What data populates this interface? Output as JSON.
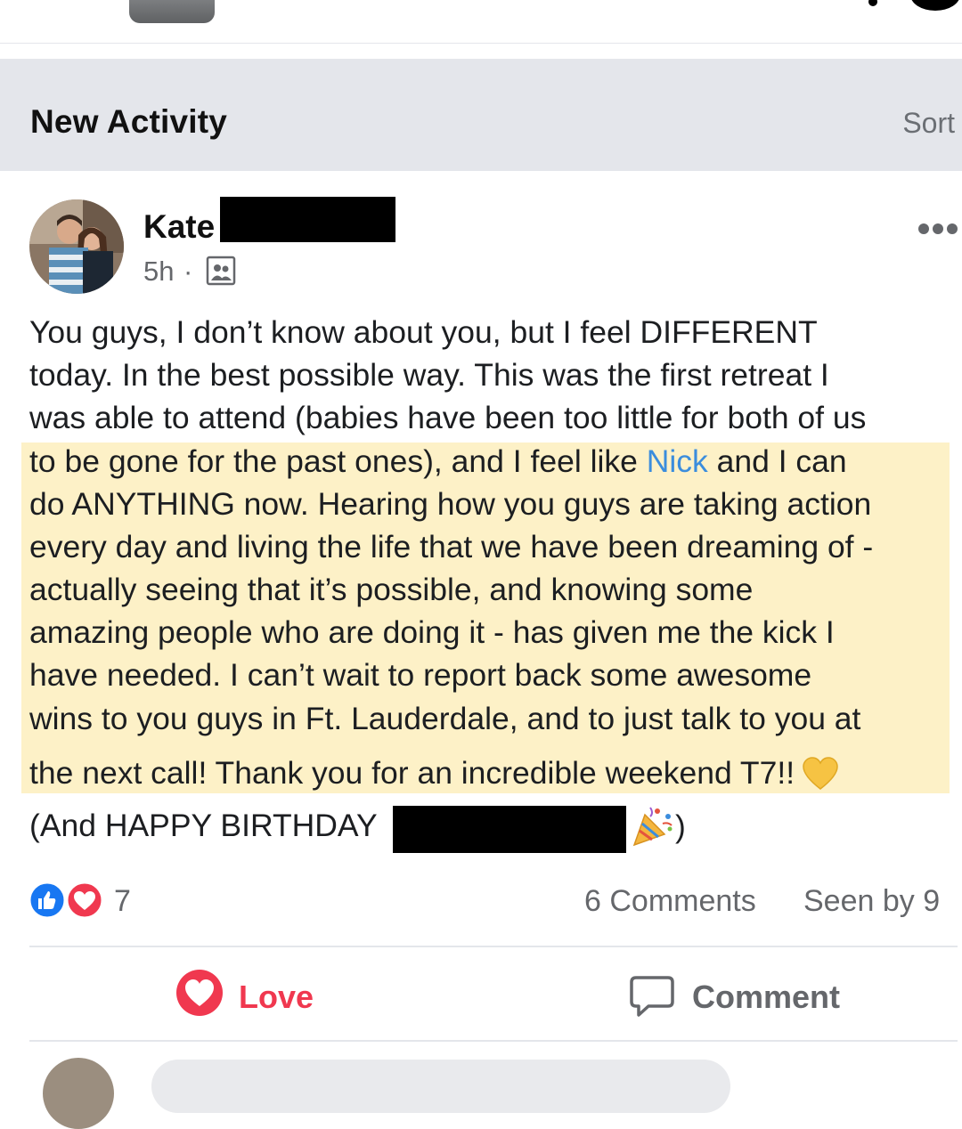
{
  "section": {
    "title": "New Activity",
    "sort_label": "Sort"
  },
  "post": {
    "author": "Kate",
    "time": "5h",
    "separator": "·",
    "body_lines": [
      "You guys, I don’t know about you, but I feel DIFFERENT",
      "today. In the best possible way. This was the first retreat I",
      "was able to attend (babies have been too little for both of us",
      "to be gone for the past ones), and I feel like ",
      "do ANYTHING now. Hearing how you guys are taking action",
      "every day and living the life that we have been dreaming of -",
      "actually seeing that it’s possible, and knowing some",
      "amazing people who are doing it - has given me the kick I",
      "have needed. I can’t wait to report back some awesome",
      "wins to you guys in Ft. Lauderdale, and to just talk to you at",
      "the next call! Thank you for an incredible weekend T7!!"
    ],
    "mention": "Nick",
    "line4_suffix": " and I can",
    "birthday_prefix": "(And HAPPY BIRTHDAY",
    "birthday_suffix": ")",
    "reaction_count": "7",
    "comments_label": "6 Comments",
    "seen_label": "Seen by 9",
    "actions": {
      "love_label": "Love",
      "comment_label": "Comment"
    },
    "icons": [
      "group-icon",
      "more-icon",
      "like-reaction-icon",
      "love-reaction-icon",
      "yellow-heart-emoji",
      "party-popper-emoji",
      "love-icon",
      "comment-icon"
    ]
  },
  "colors": {
    "header_bg": "#e4e6eb",
    "highlight": "#fdf1c7",
    "mention": "#3b8ddd",
    "love": "#f0384f",
    "like": "#1877f2",
    "muted": "#65676b"
  }
}
